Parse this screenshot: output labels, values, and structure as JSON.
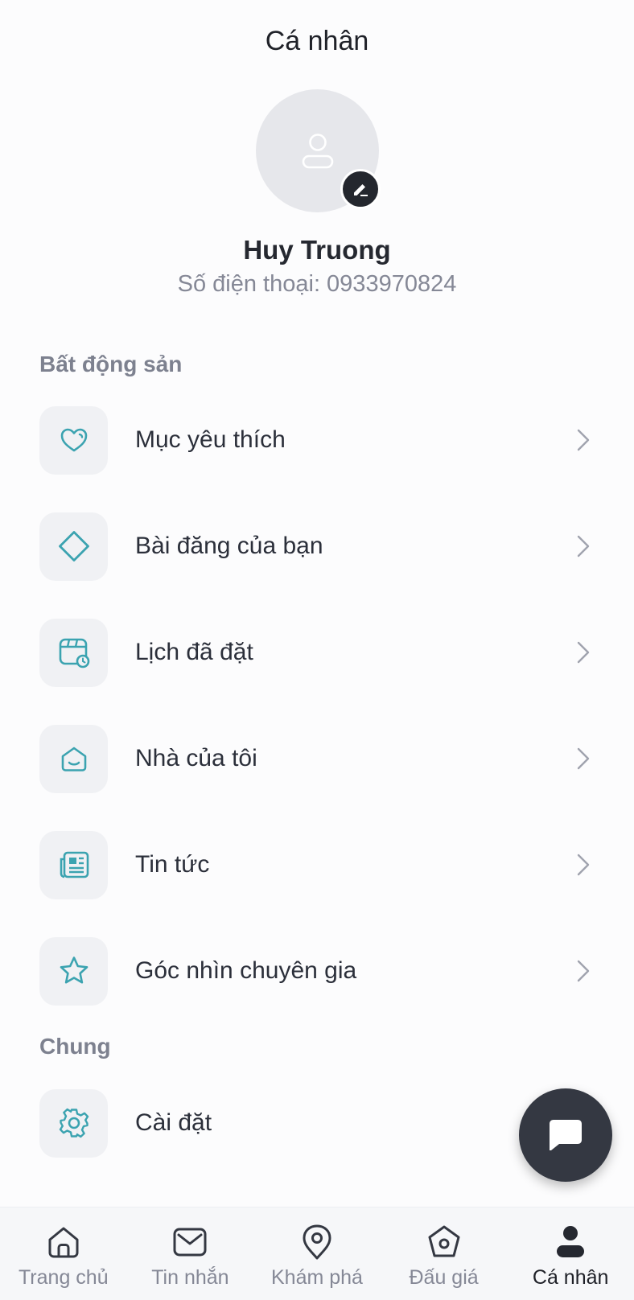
{
  "header": {
    "title": "Cá nhân"
  },
  "profile": {
    "name": "Huy Truong",
    "phone": "Số điện thoại: 0933970824"
  },
  "sections": {
    "real_estate": "Bất động sản",
    "general": "Chung"
  },
  "menu": {
    "favorites": {
      "label": "Mục yêu thích",
      "icon": "heart-icon"
    },
    "my_posts": {
      "label": "Bài đăng của bạn",
      "icon": "diamond-icon"
    },
    "bookings": {
      "label": "Lịch đã đặt",
      "icon": "calendar-clock-icon"
    },
    "my_home": {
      "label": "Nhà của tôi",
      "icon": "home-smile-icon"
    },
    "news": {
      "label": "Tin tức",
      "icon": "newspaper-icon"
    },
    "expert": {
      "label": "Góc nhìn chuyên gia",
      "icon": "star-icon"
    },
    "settings": {
      "label": "Cài đặt",
      "icon": "gear-icon"
    }
  },
  "bottom_nav": {
    "home": "Trang chủ",
    "messages": "Tin nhắn",
    "explore": "Khám phá",
    "auction": "Đấu giá",
    "profile": "Cá nhân"
  },
  "colors": {
    "accent": "#3ba3b0",
    "dark": "#343842",
    "muted": "#858896"
  }
}
